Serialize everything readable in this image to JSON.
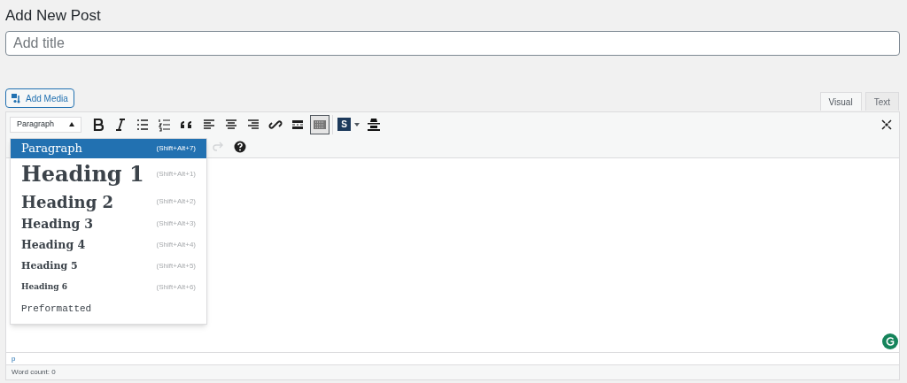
{
  "page_title": "Add New Post",
  "title_field": {
    "placeholder": "Add title"
  },
  "add_media": {
    "label": "Add Media"
  },
  "editor_tabs": [
    {
      "label": "Visual",
      "selected": true
    },
    {
      "label": "Text",
      "selected": false
    }
  ],
  "format_select": {
    "value": "Paragraph",
    "expanded": true
  },
  "toolbar": [
    {
      "kind": "bold",
      "active": false
    },
    {
      "kind": "italic",
      "active": false
    },
    {
      "kind": "bullets",
      "active": false
    },
    {
      "kind": "numbers",
      "active": false
    },
    {
      "kind": "quote",
      "active": false
    },
    {
      "kind": "align-left",
      "active": false
    },
    {
      "kind": "align-center",
      "active": false
    },
    {
      "kind": "align-right",
      "active": false
    },
    {
      "kind": "link",
      "active": false
    },
    {
      "kind": "more",
      "active": false
    },
    {
      "kind": "toolbar-toggle",
      "active": true
    },
    {
      "kind": "s-menu",
      "label": "S",
      "active": false
    },
    {
      "kind": "incognito",
      "active": false
    }
  ],
  "toolbar_row2": [
    {
      "kind": "redo",
      "disabled": true
    },
    {
      "kind": "help",
      "disabled": false
    }
  ],
  "format_menu": [
    {
      "kind": "p",
      "label": "Paragraph",
      "shortcut": "(Shift+Alt+7)",
      "selected": true
    },
    {
      "kind": "h1",
      "label": "Heading 1",
      "shortcut": "(Shift+Alt+1)",
      "selected": false
    },
    {
      "kind": "h2",
      "label": "Heading 2",
      "shortcut": "(Shift+Alt+2)",
      "selected": false
    },
    {
      "kind": "h3",
      "label": "Heading 3",
      "shortcut": "(Shift+Alt+3)",
      "selected": false
    },
    {
      "kind": "h4",
      "label": "Heading 4",
      "shortcut": "(Shift+Alt+4)",
      "selected": false
    },
    {
      "kind": "h5",
      "label": "Heading 5",
      "shortcut": "(Shift+Alt+5)",
      "selected": false
    },
    {
      "kind": "h6",
      "label": "Heading 6",
      "shortcut": "(Shift+Alt+6)",
      "selected": false
    },
    {
      "kind": "pre",
      "label": "Preformatted",
      "selected": false
    }
  ],
  "path_bar": "p",
  "word_count": "Word count: 0"
}
